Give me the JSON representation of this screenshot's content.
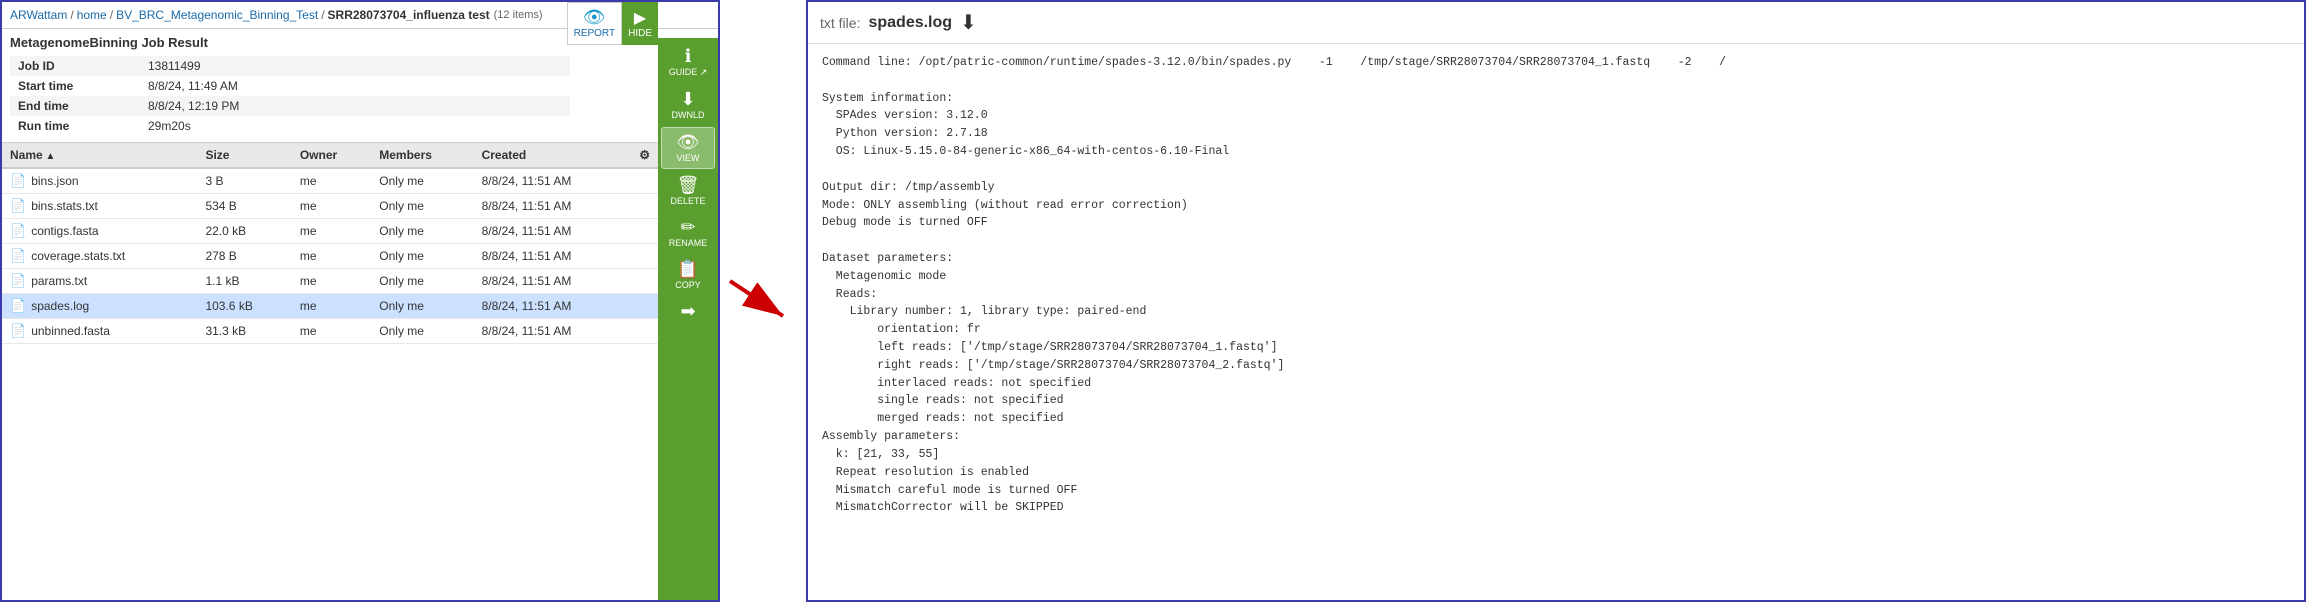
{
  "breadcrumb": {
    "home": "ARWattam",
    "sep1": "/",
    "folder1": "home",
    "sep2": "/",
    "folder2": "BV_BRC_Metagenomic_Binning_Test",
    "sep3": "/",
    "current": "SRR28073704_influenza test",
    "item_count": "(12 items)"
  },
  "report_btn": "REPORT",
  "hide_btn": "HIDE",
  "job_result_title": "MetagenomeBinning Job Result",
  "job_details": [
    {
      "label": "Job ID",
      "value": "13811499"
    },
    {
      "label": "Start time",
      "value": "8/8/24, 11:49 AM"
    },
    {
      "label": "End time",
      "value": "8/8/24, 12:19 PM"
    },
    {
      "label": "Run time",
      "value": "29m20s"
    }
  ],
  "file_table": {
    "columns": [
      "Name",
      "Size",
      "Owner",
      "Members",
      "Created"
    ],
    "rows": [
      {
        "name": "bins.json",
        "icon": "📄",
        "size": "3 B",
        "owner": "me",
        "members": "Only me",
        "created": "8/8/24, 11:51 AM",
        "selected": false
      },
      {
        "name": "bins.stats.txt",
        "icon": "📄",
        "size": "534 B",
        "owner": "me",
        "members": "Only me",
        "created": "8/8/24, 11:51 AM",
        "selected": false
      },
      {
        "name": "contigs.fasta",
        "icon": "📄",
        "size": "22.0 kB",
        "owner": "me",
        "members": "Only me",
        "created": "8/8/24, 11:51 AM",
        "selected": false
      },
      {
        "name": "coverage.stats.txt",
        "icon": "📄",
        "size": "278 B",
        "owner": "me",
        "members": "Only me",
        "created": "8/8/24, 11:51 AM",
        "selected": false
      },
      {
        "name": "params.txt",
        "icon": "📄",
        "size": "1.1 kB",
        "owner": "me",
        "members": "Only me",
        "created": "8/8/24, 11:51 AM",
        "selected": false
      },
      {
        "name": "spades.log",
        "icon": "📄",
        "size": "103.6 kB",
        "owner": "me",
        "members": "Only me",
        "created": "8/8/24, 11:51 AM",
        "selected": true
      },
      {
        "name": "unbinned.fasta",
        "icon": "📄",
        "size": "31.3 kB",
        "owner": "me",
        "members": "Only me",
        "created": "8/8/24, 11:51 AM",
        "selected": false
      }
    ]
  },
  "toolbar": {
    "buttons": [
      {
        "icon": "ℹ",
        "label": "GUIDE ↗"
      },
      {
        "icon": "⬇",
        "label": "DWNLD"
      },
      {
        "icon": "👁",
        "label": "VIEW"
      },
      {
        "icon": "🗑",
        "label": "DELETE"
      },
      {
        "icon": "✏",
        "label": "RENAME"
      },
      {
        "icon": "📋",
        "label": "COPY"
      },
      {
        "icon": "➡",
        "label": ""
      }
    ]
  },
  "right_panel": {
    "file_label": "txt file:",
    "file_name": "spades.log",
    "content": "Command line: /opt/patric-common/runtime/spades-3.12.0/bin/spades.py    -1    /tmp/stage/SRR28073704/SRR28073704_1.fastq    -2    /\n\nSystem information:\n  SPAdes version: 3.12.0\n  Python version: 2.7.18\n  OS: Linux-5.15.0-84-generic-x86_64-with-centos-6.10-Final\n\nOutput dir: /tmp/assembly\nMode: ONLY assembling (without read error correction)\nDebug mode is turned OFF\n\nDataset parameters:\n  Metagenomic mode\n  Reads:\n    Library number: 1, library type: paired-end\n        orientation: fr\n        left reads: ['/tmp/stage/SRR28073704/SRR28073704_1.fastq']\n        right reads: ['/tmp/stage/SRR28073704/SRR28073704_2.fastq']\n        interlaced reads: not specified\n        single reads: not specified\n        merged reads: not specified\nAssembly parameters:\n  k: [21, 33, 55]\n  Repeat resolution is enabled\n  Mismatch careful mode is turned OFF\n  MismatchCorrector will be SKIPPED"
  }
}
